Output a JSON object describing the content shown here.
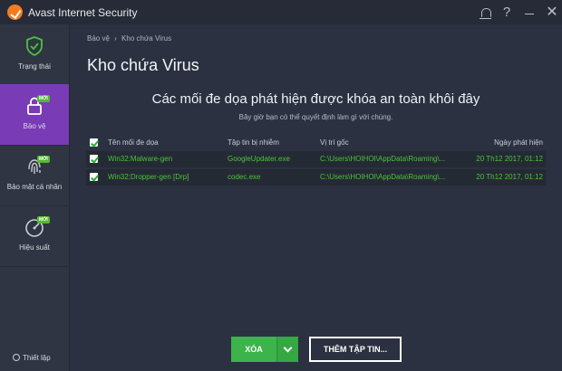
{
  "window": {
    "title": "Avast Internet Security",
    "help_label": "?",
    "close_label": "✕"
  },
  "sidebar": {
    "items": [
      {
        "label": "Trạng thái"
      },
      {
        "label": "Bảo vệ",
        "badge": "MỚI"
      },
      {
        "label": "Bảo mật cá nhân",
        "badge": "MỚI"
      },
      {
        "label": "Hiệu suất",
        "badge": "MỚI"
      }
    ],
    "settings_label": "Thiết lập"
  },
  "breadcrumb": {
    "parent": "Bảo vệ",
    "separator": "›",
    "current": "Kho chứa Virus"
  },
  "page": {
    "title": "Kho chứa Virus",
    "headline": "Các mối đe dọa phát hiện được khóa an toàn khôi đây",
    "subline": "Bây giờ bạn có thể quyết định làm gì với chúng."
  },
  "table": {
    "headers": {
      "name": "Tên mối đe dọa",
      "file": "Tập tin bị nhiễm",
      "path": "Vị trí gốc",
      "date": "Ngày phát hiện"
    },
    "rows": [
      {
        "name": "Win32:Malware-gen",
        "file": "GoogleUpdater.exe",
        "path": "C:\\Users\\HOIHOI\\AppData\\Roaming\\...",
        "date": "20 Th12 2017, 01:12"
      },
      {
        "name": "Win32:Dropper-gen [Drp]",
        "file": "codec.exe",
        "path": "C:\\Users\\HOIHOI\\AppData\\Roaming\\...",
        "date": "20 Th12 2017, 01:12"
      }
    ]
  },
  "actions": {
    "delete_label": "XÓA",
    "add_label": "THÊM TẬP TIN..."
  },
  "colors": {
    "accent_green": "#3cb44b",
    "active_nav": "#7a3bb6",
    "threat_text": "#4cc23d",
    "background": "#2b3140"
  }
}
